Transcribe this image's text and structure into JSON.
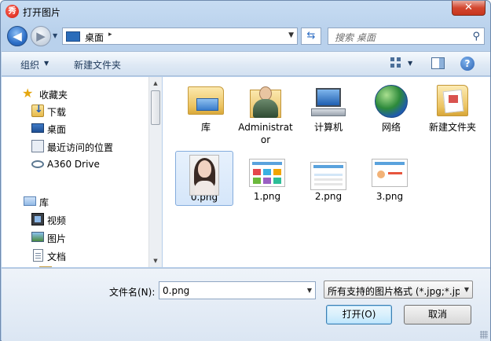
{
  "window": {
    "title": "打开图片",
    "close_symbol": "✕",
    "app_icon_glyph": "秀"
  },
  "nav": {
    "back_glyph": "◀",
    "forward_glyph": "▶"
  },
  "address": {
    "location": "桌面",
    "chevron": "▸"
  },
  "search": {
    "placeholder": "搜索 桌面"
  },
  "toolbar": {
    "organize_label": "组织",
    "new_folder_label": "新建文件夹",
    "help_glyph": "?"
  },
  "sidebar": {
    "items": [
      {
        "label": "收藏夹",
        "icon": "star-icon"
      },
      {
        "label": "下载",
        "icon": "download-folder-icon"
      },
      {
        "label": "桌面",
        "icon": "desktop-icon"
      },
      {
        "label": "最近访问的位置",
        "icon": "recent-places-icon"
      },
      {
        "label": "A360 Drive",
        "icon": "a360-drive-icon"
      },
      {
        "label": "库",
        "icon": "libraries-icon"
      },
      {
        "label": "视频",
        "icon": "video-icon"
      },
      {
        "label": "图片",
        "icon": "pictures-icon"
      },
      {
        "label": "文档",
        "icon": "documents-icon"
      }
    ]
  },
  "content": {
    "items": [
      {
        "label": "库",
        "icon": "library-folder-icon"
      },
      {
        "label": "Administrator",
        "icon": "user-folder-icon"
      },
      {
        "label": "计算机",
        "icon": "computer-icon"
      },
      {
        "label": "网络",
        "icon": "network-icon"
      },
      {
        "label": "新建文件夹",
        "icon": "new-folder-icon"
      },
      {
        "label": "0.png",
        "icon": "image-thumbnail-icon",
        "selected": true
      },
      {
        "label": "1.png",
        "icon": "image-thumbnail-icon"
      },
      {
        "label": "2.png",
        "icon": "image-thumbnail-icon"
      },
      {
        "label": "3.png",
        "icon": "image-thumbnail-icon"
      }
    ]
  },
  "bottom": {
    "filename_label": "文件名(N):",
    "filename_value": "0.png",
    "filter_value": "所有支持的图片格式 (*.jpg;*.jp",
    "open_label": "打开(O)",
    "cancel_label": "取消"
  }
}
